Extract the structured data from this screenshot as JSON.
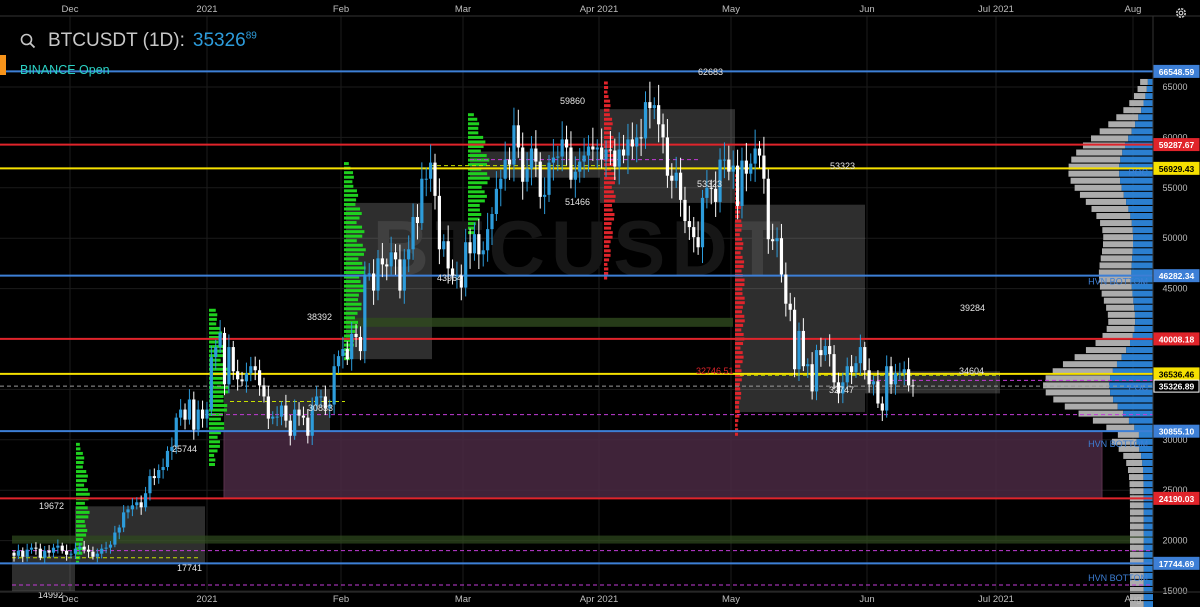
{
  "header": {
    "symbol": "BTCUSDT (1D):",
    "price": "35326",
    "price_decimals": "89",
    "exchange": "BINANCE Open",
    "icons": [
      "search-icon",
      "gear-icon"
    ]
  },
  "colors": {
    "background": "#000000",
    "bull_candle": "#2d9cdb",
    "bear_candle": "#ffffff",
    "red_level": "#e0242b",
    "yellow_level": "#f5e000",
    "blue_level": "#3d7fd6",
    "volume_zone": "#4a2a44",
    "poc_label": "#2d9cdb",
    "hvn_label": "#3d7fd6",
    "profile_up": "#1fd11f",
    "profile_down": "#e0242b"
  },
  "chart_data": {
    "type": "candlestick",
    "title": "BTCUSDT (1D)",
    "x_axis_labels": [
      "Dec",
      "2021",
      "Feb",
      "Mar",
      "Apr 2021",
      "May",
      "Jun",
      "Jul 2021",
      "Aug"
    ],
    "y_ticks": [
      65000,
      60000,
      55000,
      50000,
      45000,
      40000,
      35000,
      30000,
      25000,
      20000,
      15000
    ],
    "ylim": [
      12500,
      67500
    ],
    "grid": true,
    "price_levels": [
      {
        "label": "66548.59",
        "value": 66548.59,
        "color": "blue"
      },
      {
        "label": "59287.67",
        "value": 59287.67,
        "color": "red"
      },
      {
        "label": "56929.43",
        "value": 56929.43,
        "color": "yellow"
      },
      {
        "label": "46282.34",
        "value": 46282.34,
        "color": "blue"
      },
      {
        "label": "40008.18",
        "value": 40008.18,
        "color": "red"
      },
      {
        "label": "36536.46",
        "value": 36536.46,
        "color": "yellow"
      },
      {
        "label": "35326.89",
        "value": 35326.89,
        "color": "white"
      },
      {
        "label": "30855.10",
        "value": 30855.1,
        "color": "blue"
      },
      {
        "label": "24190.03",
        "value": 24190.03,
        "color": "red"
      },
      {
        "label": "17744.69",
        "value": 17744.69,
        "color": "blue"
      }
    ],
    "level_tags": [
      {
        "text": "POC",
        "value": 56500,
        "color": "blue"
      },
      {
        "text": "HVN BOTTOM",
        "value": 45700,
        "color": "blue"
      },
      {
        "text": "POC",
        "value": 35200,
        "color": "blue"
      },
      {
        "text": "HVN BOTTOM",
        "value": 29600,
        "color": "blue"
      },
      {
        "text": "HVN BOTTOM",
        "value": 16300,
        "color": "blue"
      }
    ],
    "annotations": [
      {
        "text": "62683",
        "value": 62683
      },
      {
        "text": "59860",
        "value": 59860
      },
      {
        "text": "53323",
        "value": 53323
      },
      {
        "text": "53323",
        "value": 53323
      },
      {
        "text": "51466",
        "value": 51466
      },
      {
        "text": "43964",
        "value": 43964
      },
      {
        "text": "38392",
        "value": 38392
      },
      {
        "text": "39284",
        "value": 39284
      },
      {
        "text": "34604",
        "value": 34604
      },
      {
        "text": "32747",
        "value": 32747
      },
      {
        "text": "32746.51",
        "value": 32746.51
      },
      {
        "text": "30833",
        "value": 30833
      },
      {
        "text": "25744",
        "value": 25744
      },
      {
        "text": "19672",
        "value": 19672
      },
      {
        "text": "17741",
        "value": 17741
      },
      {
        "text": "14992",
        "value": 14992
      }
    ],
    "watermark": "BTCUSDT",
    "closes": [
      18500,
      19000,
      18400,
      19100,
      19300,
      19200,
      18300,
      19000,
      18800,
      19300,
      19500,
      19000,
      18600,
      18700,
      19200,
      19400,
      19100,
      18900,
      18400,
      18700,
      19200,
      19300,
      19600,
      20800,
      21300,
      22800,
      23100,
      23500,
      23800,
      23300,
      24700,
      26400,
      26200,
      27000,
      27300,
      28900,
      29300,
      32200,
      33000,
      32000,
      34000,
      31000,
      33000,
      32100,
      33000,
      38200,
      39200,
      40600,
      35500,
      39200,
      36800,
      36000,
      35800,
      36600,
      37300,
      36900,
      35400,
      34300,
      32100,
      32300,
      32300,
      33400,
      31900,
      30400,
      33000,
      32400,
      32200,
      30400,
      33400,
      34300,
      34300,
      33100,
      33500,
      37300,
      38300,
      39000,
      38000,
      40500,
      40200,
      38800,
      46400,
      46500,
      44800,
      48000,
      47400,
      47200,
      48600,
      47900,
      44800,
      47900,
      48900,
      52100,
      51500,
      55900,
      55900,
      57500,
      54200,
      48900,
      49700,
      47000,
      46300,
      46300,
      45100,
      49600,
      48500,
      50400,
      48400,
      48800,
      50900,
      52400,
      54900,
      55900,
      57800,
      57300,
      61200,
      59000,
      55600,
      56900,
      58900,
      57600,
      54100,
      54300,
      57500,
      58000,
      58100,
      59800,
      59000,
      55800,
      56600,
      57600,
      58200,
      59100,
      58800,
      59000,
      57800,
      58800,
      58700,
      57100,
      58800,
      58200,
      59800,
      59100,
      60000,
      59900,
      63500,
      62900,
      63200,
      61300,
      60000,
      56200,
      55700,
      56500,
      53800,
      51700,
      51100,
      50100,
      49100,
      54000,
      55000,
      54900,
      53600,
      57800,
      57800,
      56600,
      57200,
      53200,
      57700,
      56400,
      57400,
      58900,
      58200,
      55900,
      49900,
      49700,
      50000,
      46400,
      43500,
      42900,
      37000,
      40800,
      37300,
      37500,
      34800,
      38900,
      38400,
      39300,
      38500,
      35700,
      34600,
      35700,
      37300,
      36700,
      37600,
      39200,
      36900,
      35500,
      35800,
      33600,
      32900,
      37300,
      35500,
      36600,
      36600,
      37000,
      35400,
      35300
    ]
  }
}
